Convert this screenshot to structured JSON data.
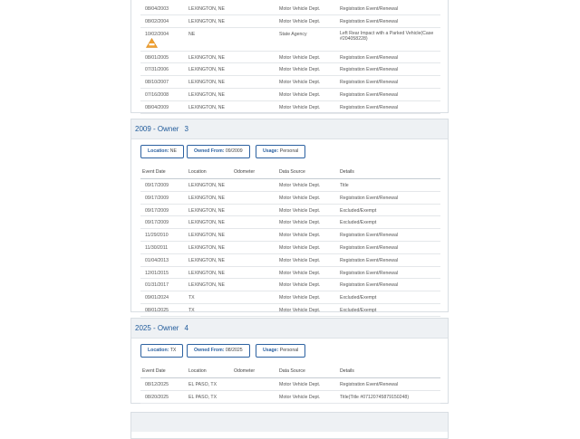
{
  "top_rows": [
    {
      "date": "08/04/2003",
      "location": "LEXINGTON, NE",
      "source": "Motor Vehicle Dept.",
      "details": "Registration Event/Renewal"
    },
    {
      "date": "08/02/2004",
      "location": "LEXINGTON, NE",
      "source": "Motor Vehicle Dept.",
      "details": "Registration Event/Renewal"
    },
    {
      "date": "10/02/2004",
      "location": "NE",
      "source": "State Agency",
      "details": "Left Rear Impact with a Parked Vehicle(Case #204058228)"
    },
    {
      "date": "08/01/2005",
      "location": "LEXINGTON, NE",
      "source": "Motor Vehicle Dept.",
      "details": "Registration Event/Renewal"
    },
    {
      "date": "07/31/2006",
      "location": "LEXINGTON, NE",
      "source": "Motor Vehicle Dept.",
      "details": "Registration Event/Renewal"
    },
    {
      "date": "08/10/2007",
      "location": "LEXINGTON, NE",
      "source": "Motor Vehicle Dept.",
      "details": "Registration Event/Renewal"
    },
    {
      "date": "07/16/2008",
      "location": "LEXINGTON, NE",
      "source": "Motor Vehicle Dept.",
      "details": "Registration Event/Renewal"
    },
    {
      "date": "08/04/2009",
      "location": "LEXINGTON, NE",
      "source": "Motor Vehicle Dept.",
      "details": "Registration Event/Renewal"
    }
  ],
  "columns": {
    "date": "Event Date",
    "location": "Location",
    "odometer": "Odometer",
    "source": "Data Source",
    "details": "Details"
  },
  "owner3": {
    "title": "2009 - Owner",
    "number": "3",
    "location_label": "Location:",
    "location": "NE",
    "owned_label": "Owned From:",
    "owned_from": "09/2009",
    "usage_label": "Usage:",
    "usage": "Personal",
    "rows": [
      {
        "date": "09/17/2009",
        "location": "LEXINGTON, NE",
        "source": "Motor Vehicle Dept.",
        "details": "Title"
      },
      {
        "date": "09/17/2009",
        "location": "LEXINGTON, NE",
        "source": "Motor Vehicle Dept.",
        "details": "Registration Event/Renewal"
      },
      {
        "date": "09/17/2009",
        "location": "LEXINGTON, NE",
        "source": "Motor Vehicle Dept.",
        "details": "Excluded/Exempt"
      },
      {
        "date": "09/17/2009",
        "location": "LEXINGTON, NE",
        "source": "Motor Vehicle Dept.",
        "details": "Excluded/Exempt"
      },
      {
        "date": "11/29/2010",
        "location": "LEXINGTON, NE",
        "source": "Motor Vehicle Dept.",
        "details": "Registration Event/Renewal"
      },
      {
        "date": "11/30/2011",
        "location": "LEXINGTON, NE",
        "source": "Motor Vehicle Dept.",
        "details": "Registration Event/Renewal"
      },
      {
        "date": "01/04/2013",
        "location": "LEXINGTON, NE",
        "source": "Motor Vehicle Dept.",
        "details": "Registration Event/Renewal"
      },
      {
        "date": "12/01/2015",
        "location": "LEXINGTON, NE",
        "source": "Motor Vehicle Dept.",
        "details": "Registration Event/Renewal"
      },
      {
        "date": "01/31/2017",
        "location": "LEXINGTON, NE",
        "source": "Motor Vehicle Dept.",
        "details": "Registration Event/Renewal"
      },
      {
        "date": "09/01/2024",
        "location": "TX",
        "source": "Motor Vehicle Dept.",
        "details": "Excluded/Exempt"
      },
      {
        "date": "08/01/2025",
        "location": "TX",
        "source": "Motor Vehicle Dept.",
        "details": "Excluded/Exempt"
      }
    ]
  },
  "owner4": {
    "title": "2025 - Owner",
    "number": "4",
    "location_label": "Location:",
    "location": "TX",
    "owned_label": "Owned From:",
    "owned_from": "08/2025",
    "usage_label": "Usage:",
    "usage": "Personal",
    "rows": [
      {
        "date": "08/12/2025",
        "location": "EL PASO, TX",
        "source": "Motor Vehicle Dept.",
        "details": "Registration Event/Renewal"
      },
      {
        "date": "08/20/2025",
        "location": "EL PASO, TX",
        "source": "Motor Vehicle Dept.",
        "details": "Title(Title #07120745879150248)"
      }
    ]
  },
  "colors": {
    "accent": "#2d62a1",
    "header_bg": "#eef1f4",
    "warning": "#f0a030"
  },
  "icons": {
    "accident": "warning-triangle-icon"
  }
}
